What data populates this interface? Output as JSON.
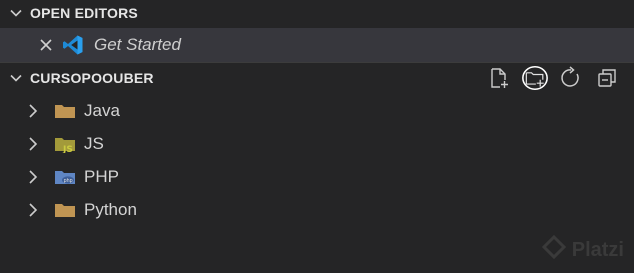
{
  "open_editors": {
    "title": "OPEN EDITORS",
    "items": [
      {
        "label": "Get Started"
      }
    ]
  },
  "project": {
    "title": "CURSOPOOUBER",
    "actions": [
      "new-file-icon",
      "new-folder-icon",
      "refresh-icon",
      "collapse-all-icon"
    ],
    "folders": [
      {
        "label": "Java",
        "icon": "folder-icon"
      },
      {
        "label": "JS",
        "icon": "folder-js-icon",
        "badge": "JS"
      },
      {
        "label": "PHP",
        "icon": "folder-php-icon",
        "badge": "php"
      },
      {
        "label": "Python",
        "icon": "folder-icon"
      }
    ]
  },
  "watermark": {
    "text": "Platzi"
  },
  "colors": {
    "sidebar_bg": "#252526",
    "selected_row": "#37373d",
    "folder": "#c09553",
    "folder_js": "#cbcb41",
    "folder_php": "#5f86c4",
    "vscode_blue": "#1e8ad6"
  }
}
